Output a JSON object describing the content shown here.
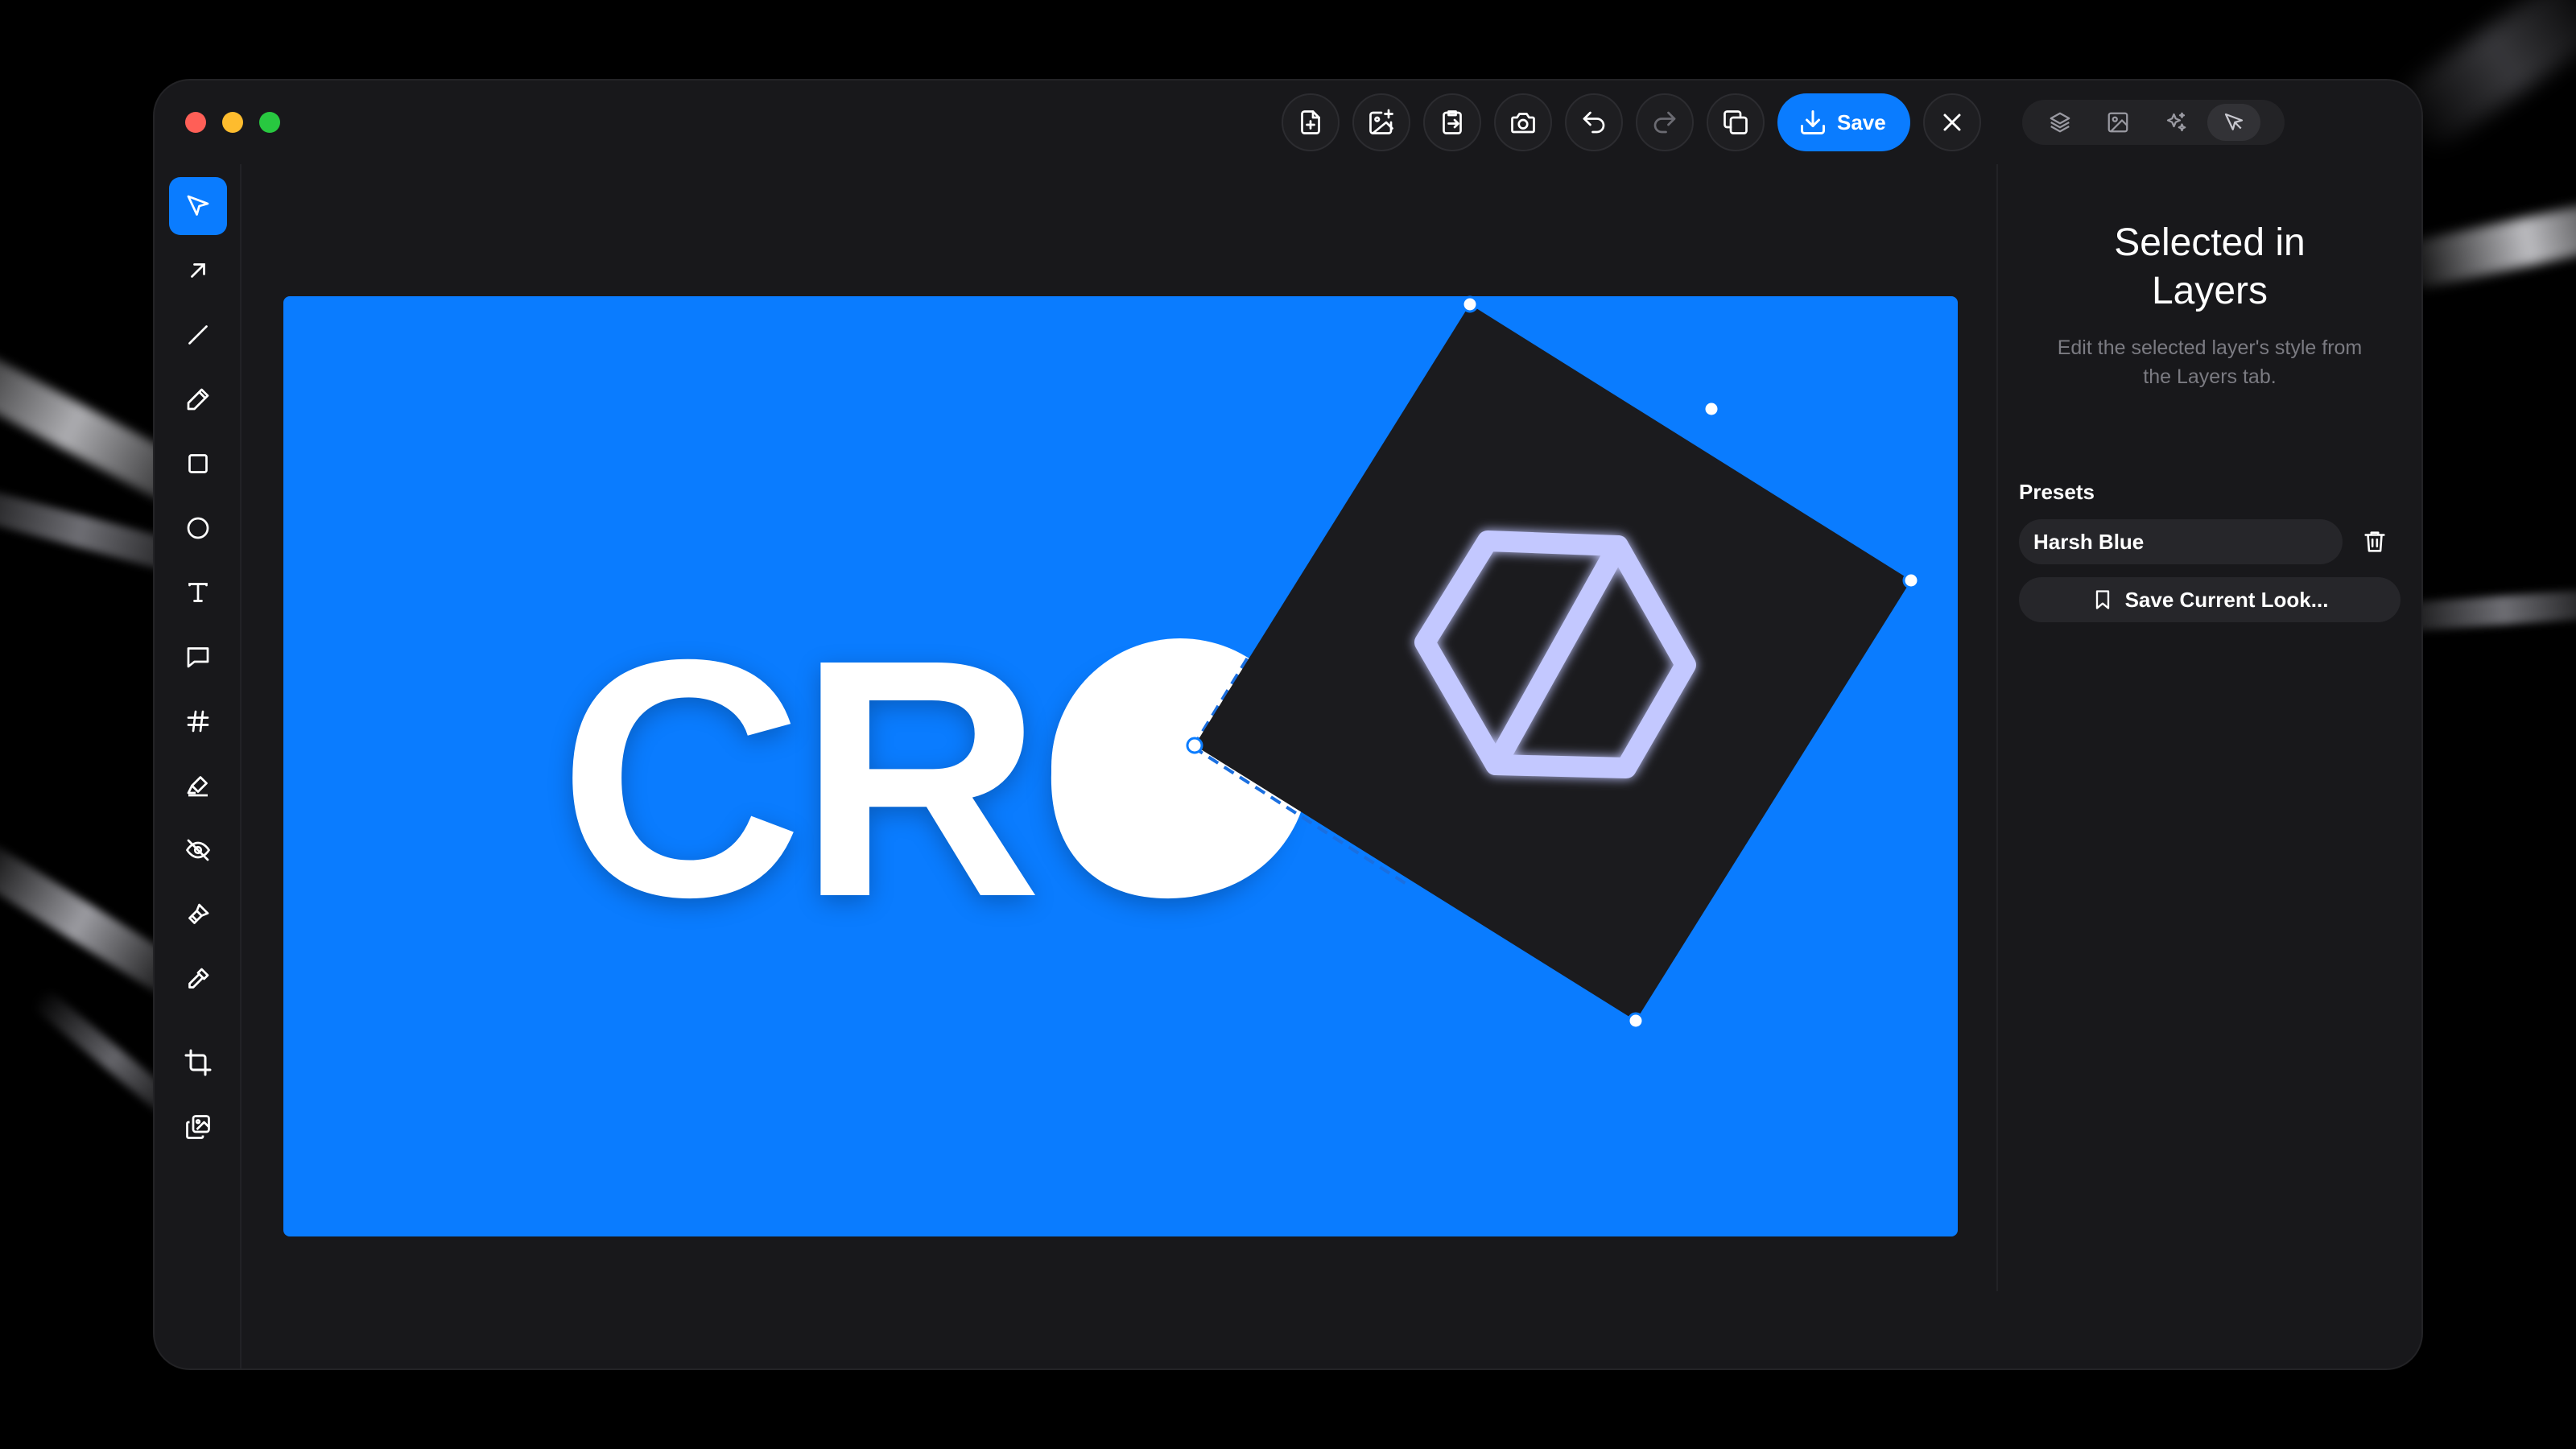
{
  "toolbar": {
    "save_label": "Save",
    "buttons": [
      "new-file-icon",
      "add-image-icon",
      "export-icon",
      "camera-icon",
      "undo-icon",
      "redo-icon",
      "copy-icon"
    ]
  },
  "tabs": [
    "layers-icon",
    "image-icon",
    "effects-icon",
    "style-icon"
  ],
  "tools": [
    "select-icon",
    "arrow-icon",
    "line-icon",
    "pencil-icon",
    "rectangle-icon",
    "ellipse-icon",
    "text-icon",
    "comment-icon",
    "hashtag-icon",
    "highlighter-icon",
    "blur-icon",
    "brush-icon",
    "eyedropper-icon",
    "crop-icon",
    "image-layers-icon"
  ],
  "canvas": {
    "text": "CRO",
    "background_color": "#0a7cff"
  },
  "panel": {
    "title": "Selected in Layers",
    "subtitle": "Edit the selected layer's style from the Layers tab.",
    "presets_label": "Presets",
    "preset_name": "Harsh Blue",
    "save_look_label": "Save Current Look..."
  },
  "colors": {
    "accent": "#0a7cff",
    "window": "#18181b",
    "logo_stroke": "#c3c8ff"
  }
}
